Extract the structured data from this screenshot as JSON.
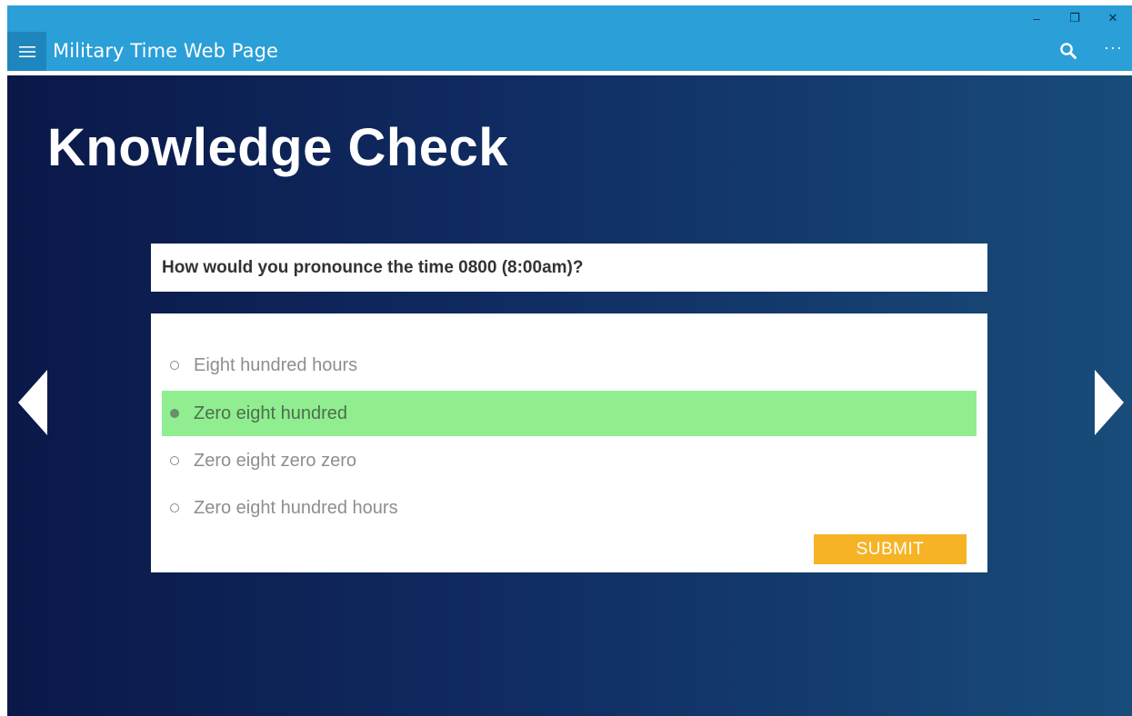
{
  "window": {
    "title": "Military Time Web Page",
    "controls": {
      "minimize": "–",
      "maximize": "❐",
      "close": "✕"
    },
    "more_label": "···"
  },
  "page": {
    "title": "Knowledge Check",
    "question": "How would you pronounce the time 0800 (8:00am)?",
    "options": [
      {
        "label": "Eight hundred hours",
        "selected": false
      },
      {
        "label": "Zero eight hundred",
        "selected": true
      },
      {
        "label": "Zero eight zero zero",
        "selected": false
      },
      {
        "label": "Zero eight hundred hours",
        "selected": false
      }
    ],
    "submit_label": "SUBMIT"
  },
  "colors": {
    "titlebar": "#2a9fd8",
    "hamburger_bg": "#1f86bd",
    "background_start": "#0a1848",
    "background_end": "#184c7a",
    "selected_option": "#90ee90",
    "submit_button": "#f6b325"
  },
  "icons": {
    "menu": "hamburger-icon",
    "search": "search-icon",
    "more": "more-icon",
    "prev": "chevron-left-icon",
    "next": "chevron-right-icon"
  }
}
